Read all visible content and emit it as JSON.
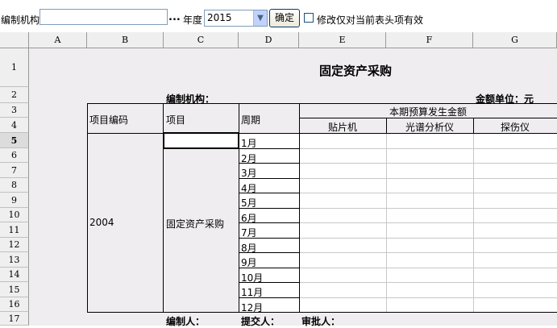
{
  "toolbar": {
    "org_label": "编制机构",
    "org_value": "",
    "ellipsis": "...",
    "year_label": "年度",
    "year_value": "2015",
    "confirm_label": "确定",
    "checkbox_label": "修改仅对当前表头项有效",
    "checkbox_checked": false
  },
  "sheet": {
    "columns": [
      "A",
      "B",
      "C",
      "D",
      "E",
      "F",
      "G"
    ],
    "rows": [
      "1",
      "2",
      "3",
      "4",
      "5",
      "6",
      "7",
      "8",
      "9",
      "10",
      "11",
      "12",
      "13",
      "14",
      "15",
      "16",
      "17"
    ],
    "active_row": "5",
    "title": "固定资产采购",
    "org_caption": "编制机构：",
    "unit_caption": "金额单位：元",
    "headers": {
      "code": "项目编码",
      "item": "项目",
      "period": "周期",
      "budget_group": "本期预算发生金额",
      "col_e": "贴片机",
      "col_f": "光谱分析仪",
      "col_g": "探伤仪"
    },
    "data": {
      "code": "2004",
      "item": "固定资产采购",
      "months": [
        "1月",
        "2月",
        "3月",
        "4月",
        "5月",
        "6月",
        "7月",
        "8月",
        "9月",
        "10月",
        "11月",
        "12月"
      ]
    },
    "footer": {
      "prepared_by": "编制人：",
      "submitted_by": "提交人：",
      "approved_by": "审批人："
    }
  }
}
